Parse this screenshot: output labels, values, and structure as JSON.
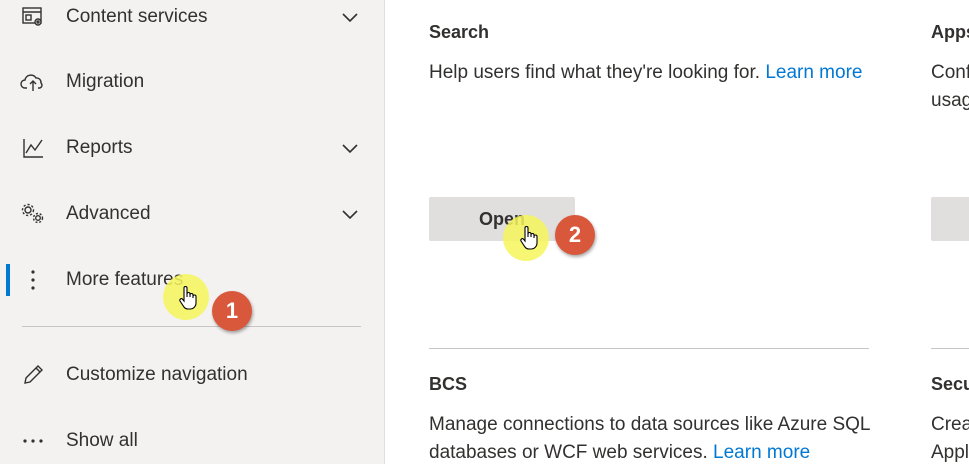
{
  "sidebar": {
    "items": [
      {
        "label": "Content services",
        "icon": "content-services-icon",
        "chevron": true
      },
      {
        "label": "Migration",
        "icon": "cloud-upload-icon",
        "chevron": false
      },
      {
        "label": "Reports",
        "icon": "chart-line-icon",
        "chevron": true
      },
      {
        "label": "Advanced",
        "icon": "gears-icon",
        "chevron": true
      },
      {
        "label": "More features",
        "icon": "more-vertical-icon",
        "chevron": false,
        "active": true
      },
      {
        "label": "Customize navigation",
        "icon": "pencil-icon",
        "chevron": false
      },
      {
        "label": "Show all",
        "icon": "more-horizontal-icon",
        "chevron": false
      }
    ]
  },
  "main": {
    "search": {
      "title": "Search",
      "description": "Help users find what they're looking for.",
      "link": "Learn more",
      "button": "Open"
    },
    "apps": {
      "title": "Apps",
      "description_partial_1": "Conf",
      "description_partial_2": "usag"
    },
    "bcs": {
      "title": "BCS",
      "description_1": "Manage connections to data sources like Azure SQL",
      "description_2": "databases or WCF web services.",
      "link": "Learn more"
    },
    "secure_store": {
      "title": "Secu",
      "description_partial_1": "Crea",
      "description_partial_2": "Appl"
    }
  },
  "annotations": {
    "step1": "1",
    "step2": "2"
  },
  "colors": {
    "accent": "#0078d4",
    "sidebar_bg": "#f3f2f1",
    "button_bg": "#e1dfdd",
    "badge": "#d9573a",
    "halo": "#f6f65a"
  }
}
